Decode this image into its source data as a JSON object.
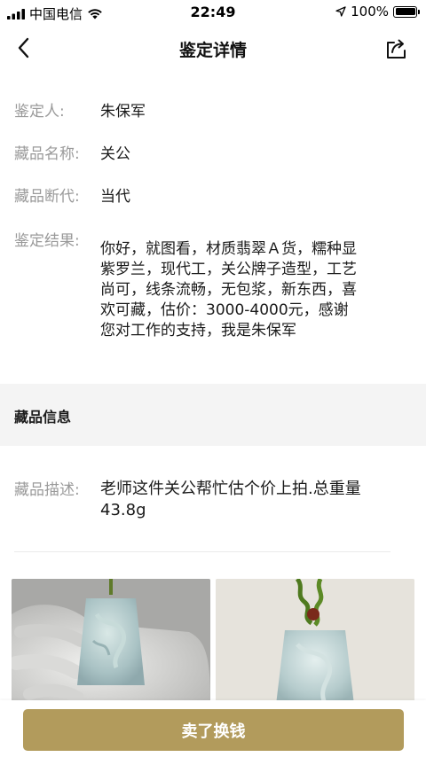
{
  "status_bar": {
    "carrier": "中国电信",
    "time": "22:49",
    "battery": "100%",
    "battery_level": 1.0
  },
  "nav": {
    "title": "鉴定详情"
  },
  "appraisal": {
    "appraiser_label": "鉴定人:",
    "appraiser_value": "朱保军",
    "item_name_label": "藏品名称:",
    "item_name_value": "关公",
    "dating_label": "藏品断代:",
    "dating_value": "当代",
    "result_label": "鉴定结果:",
    "result_lines": [
      "你好，就图看，材质翡翠Ａ货，糯种显",
      "紫罗兰，现代工，关公牌子造型，工艺",
      "尚可，线条流畅，无包浆，新东西，喜",
      "欢可藏，估价：3000-4000元，感谢",
      "您对工作的支持，我是朱保军"
    ]
  },
  "item_info": {
    "section_title": "藏品信息",
    "description_label": "藏品描述:",
    "description_lines": [
      "老师这件关公帮忙估个价上拍.总重量",
      "43.8g"
    ]
  },
  "bottom": {
    "sell_label": "卖了换钱"
  },
  "colors": {
    "accent": "#b29b5c",
    "label_gray": "#9a9a9a",
    "section_bg": "#f4f4f4"
  },
  "icons": {
    "back": "chevron-left-icon",
    "share": "share-icon",
    "signal": "signal-icon",
    "wifi": "wifi-icon",
    "location": "location-arrow-icon",
    "battery": "battery-icon"
  }
}
